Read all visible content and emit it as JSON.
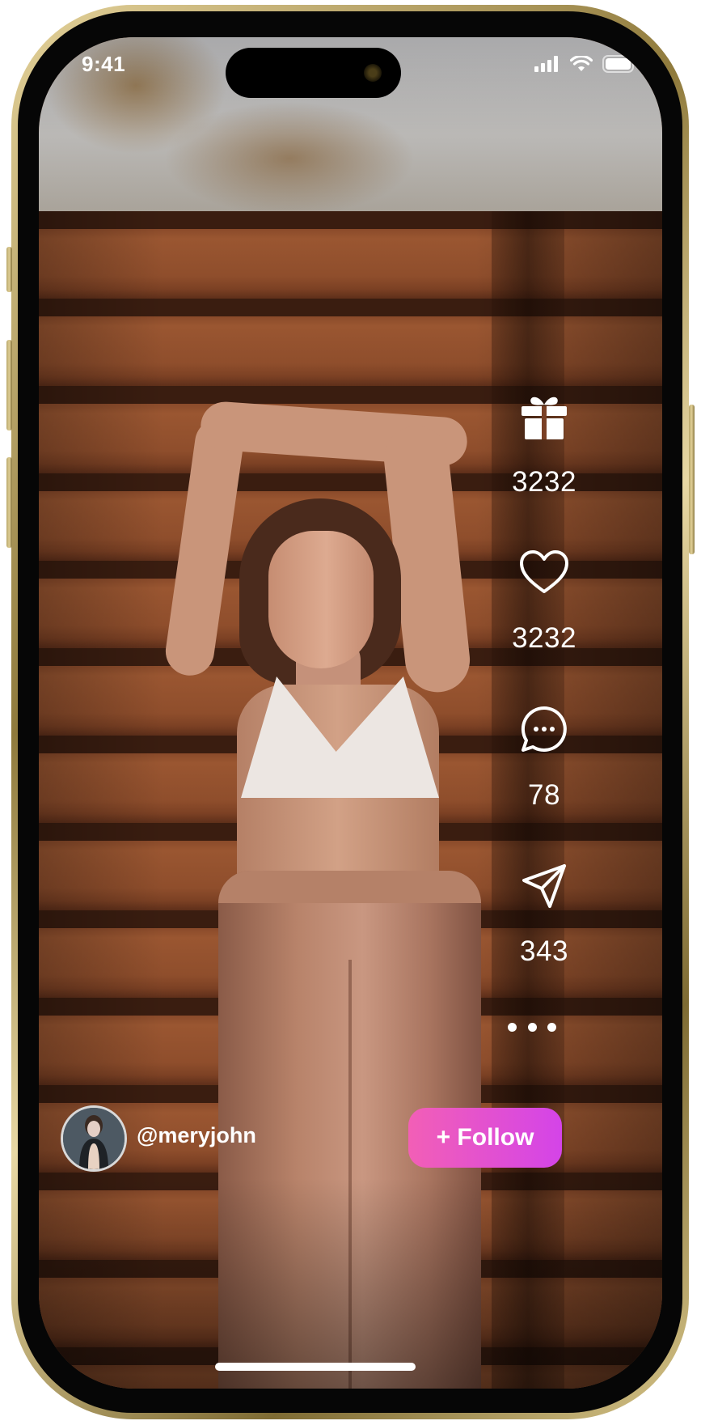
{
  "status_bar": {
    "time": "9:41"
  },
  "actions": [
    {
      "name": "gift",
      "icon": "gift-icon",
      "count": "3232"
    },
    {
      "name": "like",
      "icon": "heart-icon",
      "count": "3232"
    },
    {
      "name": "comment",
      "icon": "comment-icon",
      "count": "78"
    },
    {
      "name": "share",
      "icon": "send-icon",
      "count": "343"
    }
  ],
  "more_icon": "more-dots-icon",
  "profile": {
    "username": "@meryjohn"
  },
  "follow_button": {
    "label": "+ Follow"
  },
  "colors": {
    "follow_gradient_start": "#f25fb6",
    "follow_gradient_end": "#d444e8",
    "frame_gold": "#c9b574"
  }
}
